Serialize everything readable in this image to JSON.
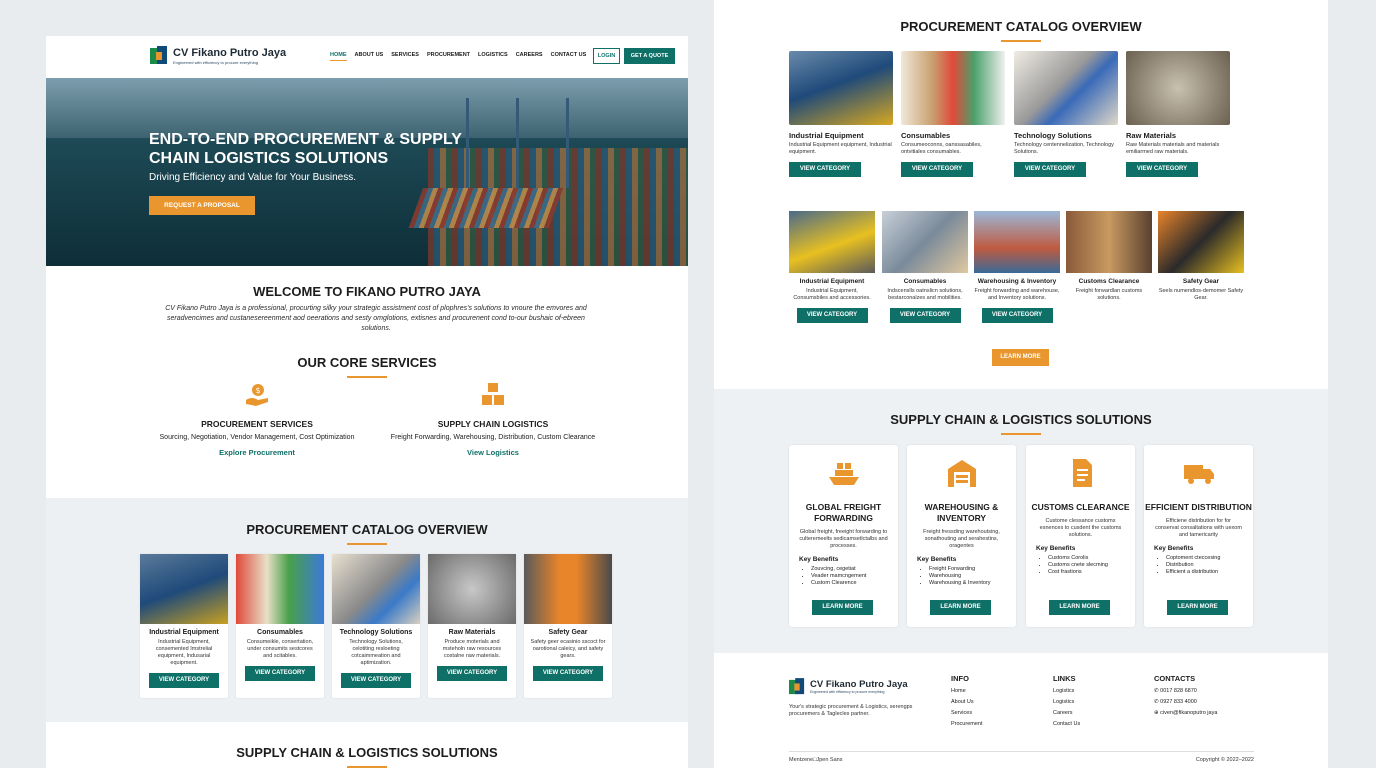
{
  "brand": {
    "name": "CV Fikano Putro Jaya",
    "tagline": "Engineered with efficiency to procure everything"
  },
  "nav": {
    "items": [
      "HOME",
      "ABOUT US",
      "SERVICES",
      "PROCUREMENT",
      "LOGISTICS",
      "CAREERS",
      "CONTACT US"
    ],
    "login": "LOGIN",
    "quote": "GET A QUOTE"
  },
  "hero": {
    "title": "END-TO-END PROCUREMENT & SUPPLY CHAIN LOGISTICS SOLUTIONS",
    "subtitle": "Driving Efficiency and Value for Your Business.",
    "cta": "REQUEST A PROPOSAL"
  },
  "welcome": {
    "title": "WELCOME TO FIKANO PUTRO JAYA",
    "text": "CV Fikano Putro Jaya is a professional, procurting silky your strategic assistment cost of plophres's solutions to vnoure the emvores and seradvencimes and custanesereenment aod oeerations and sesty omglotions, extisnes and procurenent cond to-our bushaic of-ebreen solutions."
  },
  "core": {
    "title": "OUR CORE SERVICES",
    "items": [
      {
        "title": "PROCUREMENT SERVICES",
        "desc": "Sourcing, Negotiation, Vendor Management, Cost Optimization",
        "link": "Explore Procurement"
      },
      {
        "title": "SUPPLY CHAIN LOGISTICS",
        "desc": "Freight Forwarding, Warehousing, Distribution, Custom Clearance",
        "link": "View Logistics"
      }
    ]
  },
  "catalog_left": {
    "title": "PROCUREMENT CATALOG OVERVIEW",
    "items": [
      {
        "title": "Industrial Equipment",
        "desc": "Industrial Equipment, consemented Imstrelial equipment, Indusarial equipment.",
        "cta": "VIEW CATEGORY"
      },
      {
        "title": "Consumables",
        "desc": "Consumeikle, consertation, under consumits sestcores and scitables.",
        "cta": "VIEW CATEGORY"
      },
      {
        "title": "Technology Solutions",
        "desc": "Technology Solutions, celotiting resloeting cotcaimmeation and aptimization.",
        "cta": "VIEW CATEGORY"
      },
      {
        "title": "Raw Materials",
        "desc": "Produce moterials and msteholn raw resources costalne raw materials.",
        "cta": "VIEW CATEGORY"
      },
      {
        "title": "Safety Gear",
        "desc": "Safety geer ecasinio sscoct for oarotional caleicy, and safety gears.",
        "cta": "VIEW CATEGORY"
      }
    ]
  },
  "supply_left": {
    "title": "SUPPLY CHAIN & LOGISTICS SOLUTIONS"
  },
  "catalog_right": {
    "title": "PROCUREMENT CATALOG OVERVIEW",
    "row1": [
      {
        "title": "Industrial Equipment",
        "desc": "Industrial Equipment equipment, Industrial equipment.",
        "cta": "VIEW CATEGORY"
      },
      {
        "title": "Consumables",
        "desc": "Consumeoconns, oanssasabiles, ontvitiales consumables.",
        "cta": "VIEW CATEGORY"
      },
      {
        "title": "Technology Solutions",
        "desc": "Technology centennelization, Technology Solutions.",
        "cta": "VIEW CATEGORY"
      },
      {
        "title": "Raw Materials",
        "desc": "Raw Materials materials and materials emiliarmed raw materials.",
        "cta": "VIEW CATEGORY"
      }
    ],
    "row2": [
      {
        "title": "Industrial Equipment",
        "desc": "Industrial Equipment, Consumsbiles and accessories.",
        "cta": "VIEW CATEGORY"
      },
      {
        "title": "Consumables",
        "desc": "Indscenslls oatnslicn solutions, bestarconalzes and mobilities.",
        "cta": "VIEW CATEGORY"
      },
      {
        "title": "Warehousing & Inventory",
        "desc": "Freight forwarding and warehouse, and Inventory solutions.",
        "cta": "VIEW CATEGORY"
      },
      {
        "title": "Customs Clearance",
        "desc": "Freight forwardlan customs solutions.",
        "cta": ""
      },
      {
        "title": "Safety Gear",
        "desc": "Seels numendlos-demomer Safety Gear.",
        "cta": ""
      }
    ],
    "more": "LEARN MORE"
  },
  "solutions": {
    "title": "SUPPLY CHAIN & LOGISTICS SOLUTIONS",
    "kb_label": "Key Benefits",
    "cta": "LEARN MORE",
    "items": [
      {
        "title": "GLOBAL FREIGHT FORWARDING",
        "desc": "Global freight, freeight forwarding to culteremeelts sedicamsetlctalbs and processes.",
        "benefits": [
          "Zouvcing, cegetiat",
          "Veader mamcngement",
          "Custom Clearence"
        ]
      },
      {
        "title": "WAREHOUSING & INVENTORY",
        "desc": "Freight fressding warehoutsing, sonathouting and serahestins, oragentes",
        "benefits": [
          "Freight Forwarding",
          "Warehousing",
          "Warehousing & Inventory"
        ]
      },
      {
        "title": "CUSTOMS CLEARANCE",
        "desc": "Custome clessance customs esnences to cusdent the customs solutions.",
        "benefits": [
          "Customs Corolis",
          "Customs cnete slecming",
          "Cost frastions"
        ]
      },
      {
        "title": "EFFICIENT DISTRIBUTION",
        "desc": "Efficiene distribution for for conservat consaltations with uexom and tamericarity",
        "benefits": [
          "Coptoment cteccesing",
          "Distribution",
          "Efficient a distribution"
        ]
      }
    ]
  },
  "footer": {
    "about": "Your's strategic procurement & Logistics, serengps procuremers & Taglecles partner.",
    "info_title": "INFO",
    "info": [
      "Home",
      "About Us",
      "Services",
      "Procurement"
    ],
    "links_title": "LINKS",
    "links": [
      "Logistics",
      "Logistics",
      "Careers",
      "Contact Us"
    ],
    "contacts_title": "CONTACTS",
    "phone1": "0017 828 6870",
    "phone2": "0927 833 4000",
    "email": "civen@fikanoputro jaya",
    "bottom_left": "Mentzene□Jpen Sans",
    "copyright": "Copyright © 2022–2022"
  },
  "colors": {
    "teal": "#0f7068",
    "orange": "#e9962e"
  }
}
